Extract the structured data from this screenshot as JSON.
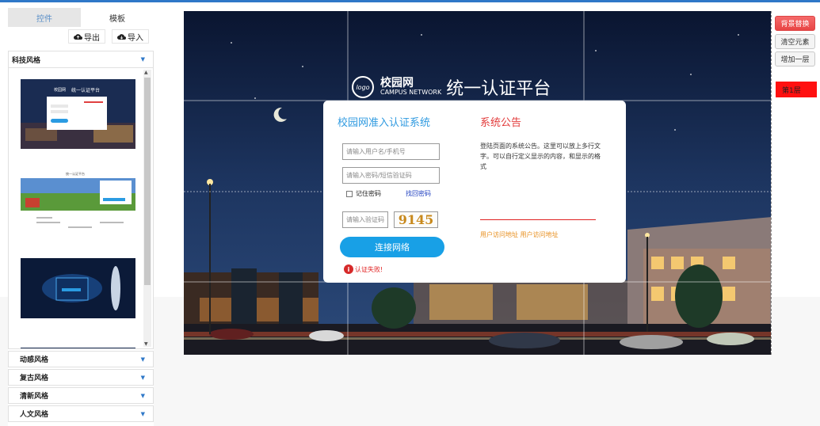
{
  "left_panel": {
    "tabs": [
      {
        "label": "控件",
        "active": false
      },
      {
        "label": "模板",
        "active": true
      }
    ],
    "export_label": "导出",
    "import_label": "导入",
    "open_section": "科技风格",
    "other_sections": [
      "动感风格",
      "复古风格",
      "清新风格",
      "人文风格"
    ],
    "thumb1": {
      "logo": "校园网",
      "title": "统一认证平台"
    },
    "thumb2": {
      "title": "统一认证平台"
    }
  },
  "login_page": {
    "logo_cn": "校园网",
    "logo_en": "CAMPUS NETWORK",
    "logo_badge": "logo",
    "platform_title": "统一认证平台",
    "form_title": "校园网准入认证系统",
    "username_placeholder": "请输入用户名/手机号",
    "password_placeholder": "请输入密码/短信验证码",
    "remember_label": "记住密码",
    "forgot_label": "找回密码",
    "captcha_placeholder": "请输入验证码",
    "captcha_value": "9145",
    "connect_label": "连接网络",
    "error_text": "认证失败!",
    "notice_title": "系统公告",
    "notice_body": "登陆页面的系统公告。这里可以放上多行文字。可以自行定义显示的内容，和显示的格式",
    "user_link": "用户访问地址 用户访问地址"
  },
  "tools": {
    "replace_bg": "背景替换",
    "clear": "清空元素",
    "add_layer": "增加一层",
    "layer1": "第1层"
  },
  "colors": {
    "accent": "#2f9ae0",
    "notice": "#e23a3a",
    "button": "#18a0e6",
    "layer": "#ff1010"
  }
}
